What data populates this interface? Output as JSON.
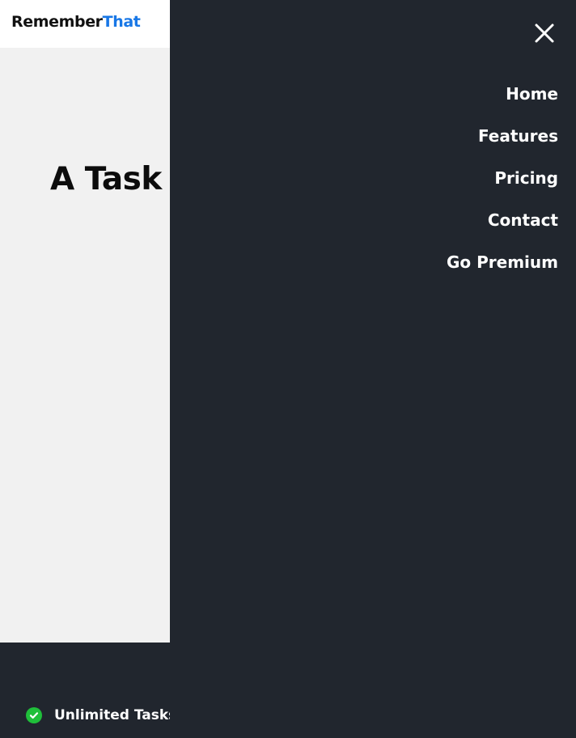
{
  "header": {
    "logo_primary": "Remember",
    "logo_accent": "That"
  },
  "hero": {
    "title": "A Task A"
  },
  "features": [
    {
      "label": "Unlimited Tasks",
      "icon": "check-circle-icon"
    }
  ],
  "nav": {
    "close_icon": "close-icon",
    "items": [
      {
        "label": "Home"
      },
      {
        "label": "Features"
      },
      {
        "label": "Pricing"
      },
      {
        "label": "Contact"
      },
      {
        "label": "Go Premium"
      }
    ]
  },
  "colors": {
    "drawer_bg": "#21262e",
    "accent": "#1877e6",
    "check": "#1fbf3a",
    "hero_bg": "#f1f1f1"
  }
}
